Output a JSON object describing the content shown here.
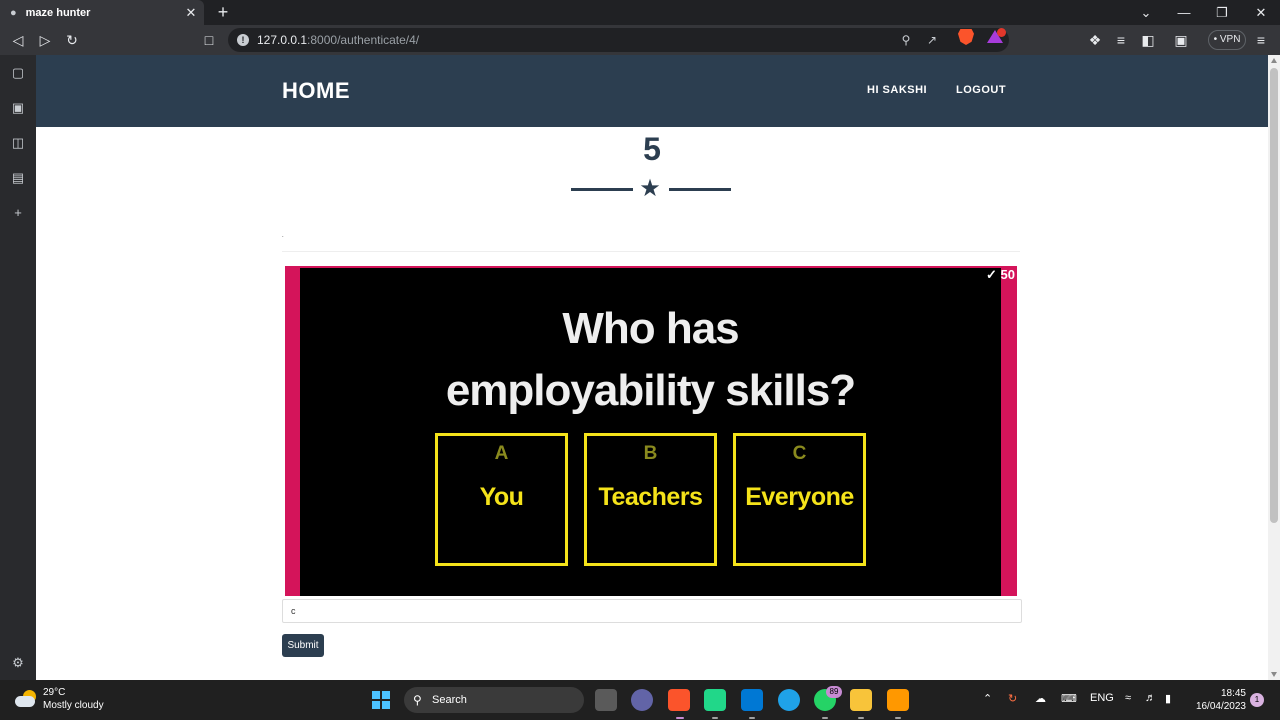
{
  "browser": {
    "tab_title": "maze hunter",
    "url_host": "127.0.0.1",
    "url_path": ":8000/authenticate/4/",
    "vpn_label": "VPN"
  },
  "nav": {
    "brand": "HOME",
    "greeting": "HI SAKSHI",
    "logout": "LOGOUT"
  },
  "level": {
    "number": "5",
    "marker": "."
  },
  "question": {
    "score": "✓ 50",
    "text_line1": "Who has",
    "text_line2": "employability skills?",
    "options": [
      {
        "letter": "A",
        "label": "You"
      },
      {
        "letter": "B",
        "label": "Teachers"
      },
      {
        "letter": "C",
        "label": "Everyone"
      }
    ]
  },
  "form": {
    "answer_value": "c",
    "submit_label": "Submit"
  },
  "taskbar": {
    "temperature": "29°C",
    "condition": "Mostly cloudy",
    "search_label": "Search",
    "whatsapp_badge": "89",
    "language": "ENG",
    "time": "18:45",
    "date": "16/04/2023",
    "notification_count": "1"
  },
  "colors": {
    "navbar": "#2c3e50",
    "question_border": "#d4145a",
    "option_yellow": "#f5e31a"
  }
}
